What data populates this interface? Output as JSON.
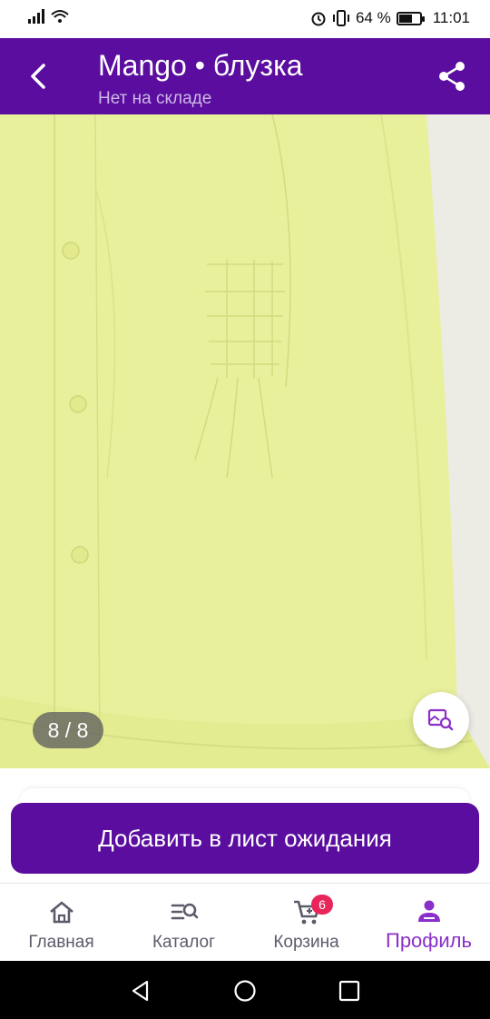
{
  "status_bar": {
    "battery_text": "64 %",
    "battery_level": 0.64,
    "time": "11:01",
    "icons": [
      "signal-icon",
      "wifi-icon",
      "alarm-icon",
      "vibrate-icon",
      "battery-icon"
    ]
  },
  "header": {
    "title": "Mango  •  блузка",
    "subtitle": "Нет на складе",
    "back_icon": "chevron-left-icon",
    "share_icon": "share-icon"
  },
  "gallery": {
    "counter": "8 / 8",
    "image_color": "#e8ef9a",
    "search_icon": "image-search-icon"
  },
  "actions": {
    "wait_button_label": "Добавить в лист ожидания"
  },
  "bottom_nav": {
    "items": [
      {
        "label": "Главная",
        "icon": "home-icon"
      },
      {
        "label": "Каталог",
        "icon": "catalog-search-icon"
      },
      {
        "label": "Корзина",
        "icon": "cart-icon",
        "badge": "6"
      },
      {
        "label": "Профиль",
        "icon": "profile-icon",
        "active": true
      }
    ]
  },
  "colors": {
    "brand": "#5a0d9e",
    "active_nav": "#8a2fc9",
    "badge": "#e8265b"
  }
}
